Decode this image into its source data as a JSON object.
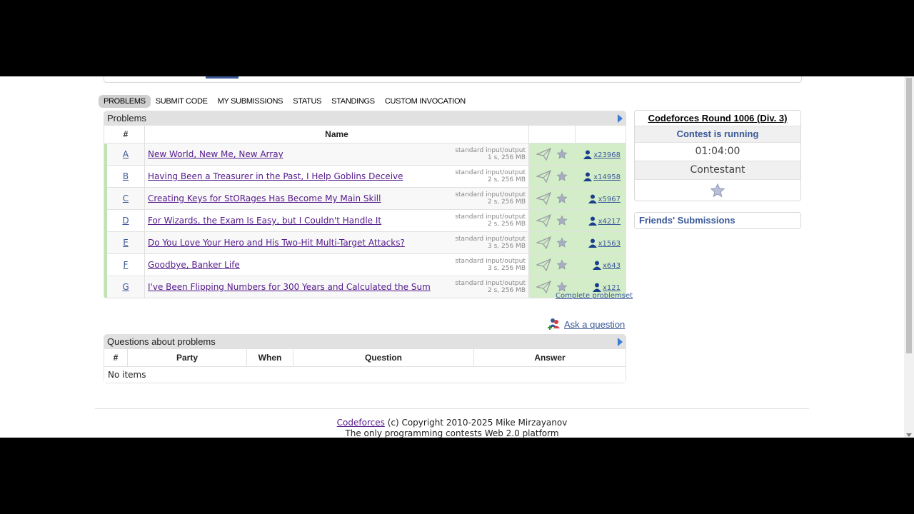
{
  "menu": {
    "items": [
      {
        "label": "PROBLEMS",
        "active": true
      },
      {
        "label": "SUBMIT CODE"
      },
      {
        "label": "MY SUBMISSIONS"
      },
      {
        "label": "STATUS"
      },
      {
        "label": "STANDINGS"
      },
      {
        "label": "CUSTOM INVOCATION"
      }
    ]
  },
  "problems": {
    "caption": "Problems",
    "headers": {
      "id": "#",
      "name": "Name"
    },
    "rows": [
      {
        "id": "A",
        "name": "New World, New Me, New Array",
        "io": "standard input/output",
        "limits": "1 s, 256 MB",
        "solved": "x23968"
      },
      {
        "id": "B",
        "name": "Having Been a Treasurer in the Past, I Help Goblins Deceive",
        "io": "standard input/output",
        "limits": "2 s, 256 MB",
        "solved": "x14958"
      },
      {
        "id": "C",
        "name": "Creating Keys for StORages Has Become My Main Skill",
        "io": "standard input/output",
        "limits": "2 s, 256 MB",
        "solved": "x5967"
      },
      {
        "id": "D",
        "name": "For Wizards, the Exam Is Easy, but I Couldn't Handle It",
        "io": "standard input/output",
        "limits": "2 s, 256 MB",
        "solved": "x4217"
      },
      {
        "id": "E",
        "name": "Do You Love Your Hero and His Two-Hit Multi-Target Attacks?",
        "io": "standard input/output",
        "limits": "3 s, 256 MB",
        "solved": "x1563"
      },
      {
        "id": "F",
        "name": "Goodbye, Banker Life",
        "io": "standard input/output",
        "limits": "3 s, 256 MB",
        "solved": "x643"
      },
      {
        "id": "G",
        "name": "I've Been Flipping Numbers for 300 Years and Calculated the Sum",
        "io": "standard input/output",
        "limits": "2 s, 256 MB",
        "solved": "x121"
      }
    ],
    "complete_link": "Complete problemset"
  },
  "ask": {
    "label": "Ask a question"
  },
  "questions": {
    "caption": "Questions about problems",
    "headers": {
      "id": "#",
      "party": "Party",
      "when": "When",
      "question": "Question",
      "answer": "Answer"
    },
    "empty": "No items"
  },
  "sidebar": {
    "contest_name": "Codeforces Round 1006 (Div. 3)",
    "status": "Contest is running",
    "timer": "01:04:00",
    "role": "Contestant",
    "friends_title": "Friends' Submissions"
  },
  "footer": {
    "site": "Codeforces",
    "copyright": " (c) Copyright 2010-2025 Mike Mirzayanov",
    "tagline": "The only programming contests Web 2.0 platform"
  },
  "colors": {
    "link": "#3b5998",
    "visited": "#551a8b",
    "accepted_bg": "#d4edc9"
  }
}
